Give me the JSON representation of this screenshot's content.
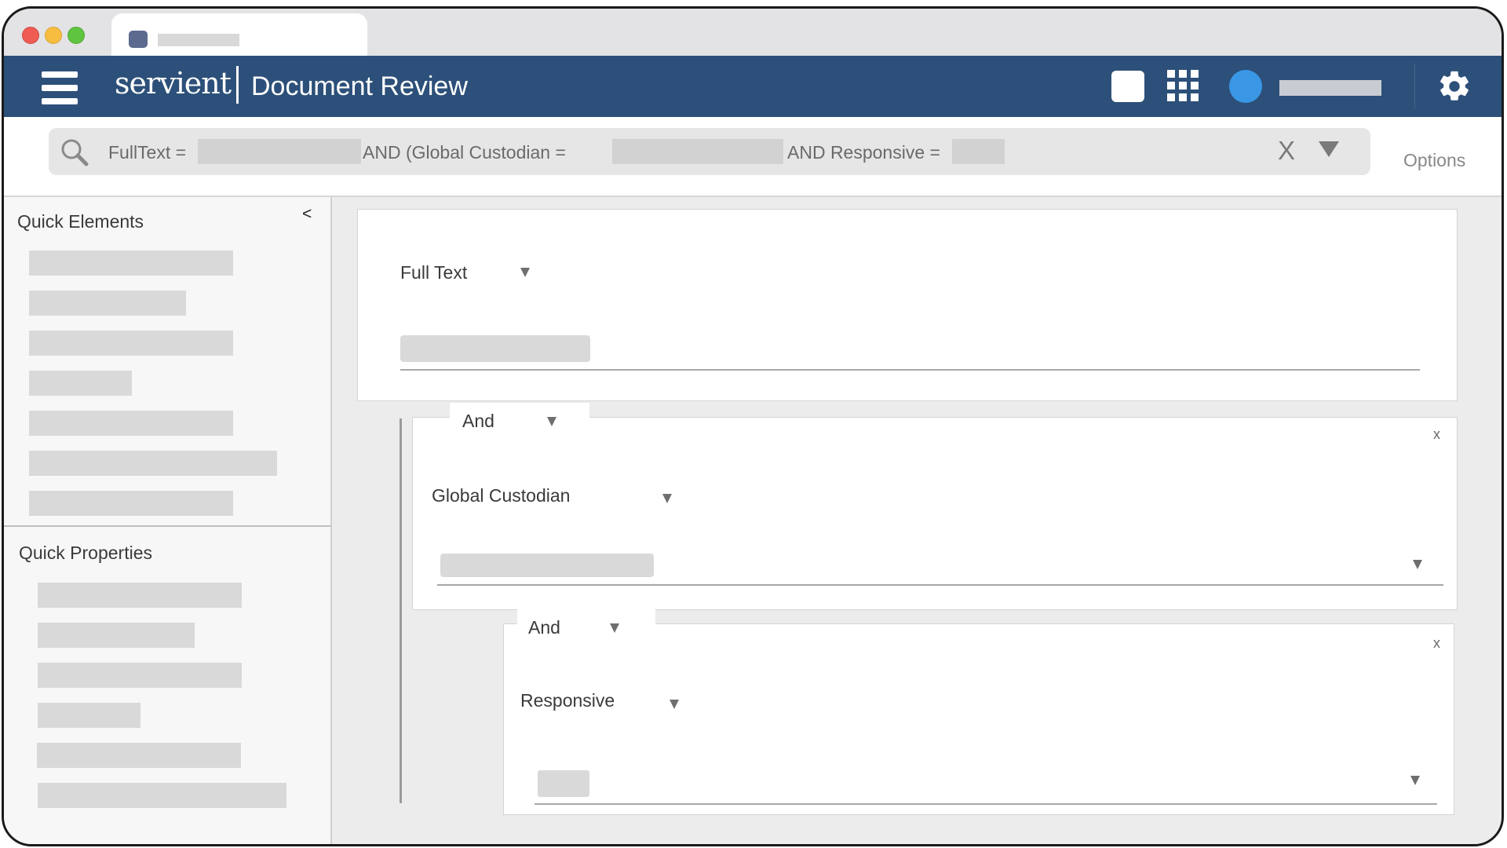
{
  "browser": {
    "tab_title": ""
  },
  "header": {
    "logo": "servient",
    "title": "Document Review"
  },
  "search": {
    "q_fulltext": "FullText =",
    "q_custodian": "AND (Global Custodian =",
    "q_responsive": "AND Responsive =",
    "clear": "X",
    "options": "Options"
  },
  "sidebar": {
    "quick_elements_title": "Quick Elements",
    "collapse": "<",
    "quick_properties_title": "Quick Properties"
  },
  "builder": {
    "block1": {
      "field": "Full Text"
    },
    "block2": {
      "operator": "And",
      "field": "Global Custodian",
      "close": "x"
    },
    "block3": {
      "operator": "And",
      "field": "Responsive",
      "close": "x"
    }
  },
  "colors": {
    "header_bg": "#2c5079",
    "avatar": "#3a97e6",
    "close_red": "#ee5c54",
    "minimize_yellow": "#f6bd3f",
    "maximize_green": "#5fc440"
  },
  "icons": [
    "menu-icon",
    "grid-icon",
    "avatar",
    "gear-icon",
    "search-icon",
    "chevron-down-icon",
    "close-icon"
  ]
}
